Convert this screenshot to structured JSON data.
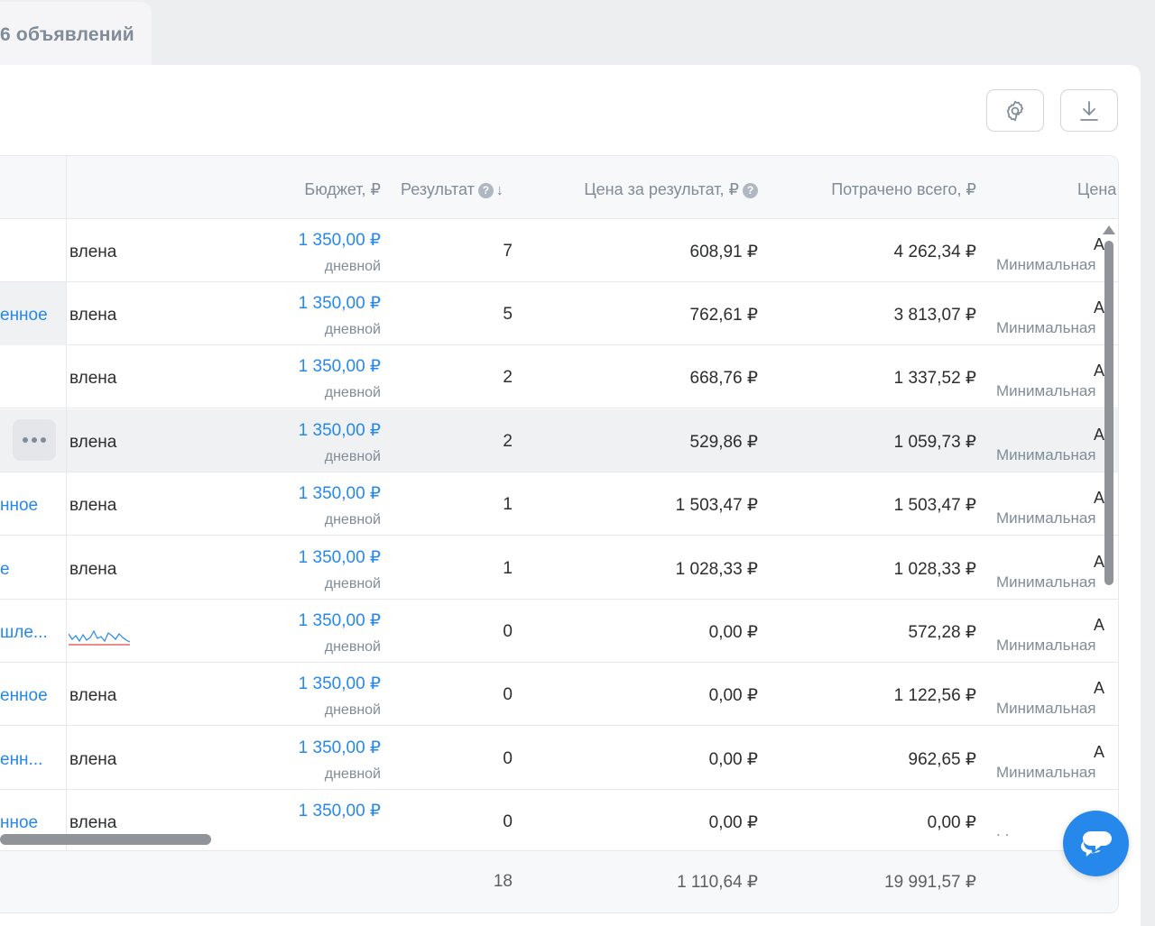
{
  "tab": {
    "label": "6 объявлений"
  },
  "toolbar": {
    "settings_icon": "gear-icon",
    "download_icon": "download-icon"
  },
  "columns": {
    "budget": "Бюджет, ₽",
    "result": "Результат",
    "price_per_result": "Цена за результат, ₽",
    "spent_total": "Потрачено всего, ₽",
    "price": "Цена"
  },
  "rows": [
    {
      "name": "",
      "status": "влена",
      "budget": "1 350,00 ₽",
      "budget_type": "дневной",
      "result": "7",
      "price": "608,91 ₽",
      "spent": "4 262,34 ₽",
      "cena_top": "А",
      "cena_sub": "Минимальная"
    },
    {
      "name": "енное",
      "status": "влена",
      "budget": "1 350,00 ₽",
      "budget_type": "дневной",
      "result": "5",
      "price": "762,61 ₽",
      "spent": "3 813,07 ₽",
      "cena_top": "А",
      "cena_sub": "Минимальная"
    },
    {
      "name": "",
      "status": "влена",
      "budget": "1 350,00 ₽",
      "budget_type": "дневной",
      "result": "2",
      "price": "668,76 ₽",
      "spent": "1 337,52 ₽",
      "cena_top": "А",
      "cena_sub": "Минимальная"
    },
    {
      "name": "",
      "status": "влена",
      "budget": "1 350,00 ₽",
      "budget_type": "дневной",
      "result": "2",
      "price": "529,86 ₽",
      "spent": "1 059,73 ₽",
      "cena_top": "А",
      "cena_sub": "Минимальная"
    },
    {
      "name": "нное",
      "status": "влена",
      "budget": "1 350,00 ₽",
      "budget_type": "дневной",
      "result": "1",
      "price": "1 503,47 ₽",
      "spent": "1 503,47 ₽",
      "cena_top": "А",
      "cena_sub": "Минимальная"
    },
    {
      "name": "е",
      "status": "влена",
      "budget": "1 350,00 ₽",
      "budget_type": "дневной",
      "result": "1",
      "price": "1 028,33 ₽",
      "spent": "1 028,33 ₽",
      "cena_top": "А",
      "cena_sub": "Минимальная"
    },
    {
      "name": "шле...",
      "status": "",
      "budget": "1 350,00 ₽",
      "budget_type": "дневной",
      "result": "0",
      "price": "0,00 ₽",
      "spent": "572,28 ₽",
      "cena_top": "А",
      "cena_sub": "Минимальная"
    },
    {
      "name": "енное",
      "status": "влена",
      "budget": "1 350,00 ₽",
      "budget_type": "дневной",
      "result": "0",
      "price": "0,00 ₽",
      "spent": "1 122,56 ₽",
      "cena_top": "А",
      "cena_sub": "Минимальная"
    },
    {
      "name": "енн...",
      "status": "влена",
      "budget": "1 350,00 ₽",
      "budget_type": "дневной",
      "result": "0",
      "price": "0,00 ₽",
      "spent": "962,65 ₽",
      "cena_top": "А",
      "cena_sub": "Минимальная"
    },
    {
      "name": "нное",
      "status": "влена",
      "budget": "1 350,00 ₽",
      "budget_type": "",
      "result": "0",
      "price": "0,00 ₽",
      "spent": "0,00 ₽",
      "cena_top": "",
      "cena_sub": ". ."
    }
  ],
  "totals": {
    "result": "18",
    "price": "1 110,64 ₽",
    "spent": "19 991,57 ₽"
  },
  "colors": {
    "accent": "#2688eb",
    "muted": "#818c99",
    "chart_blue": "#2688eb",
    "chart_pink": "#e64646"
  },
  "chat": {
    "icon": "chat-bubbles-icon"
  }
}
